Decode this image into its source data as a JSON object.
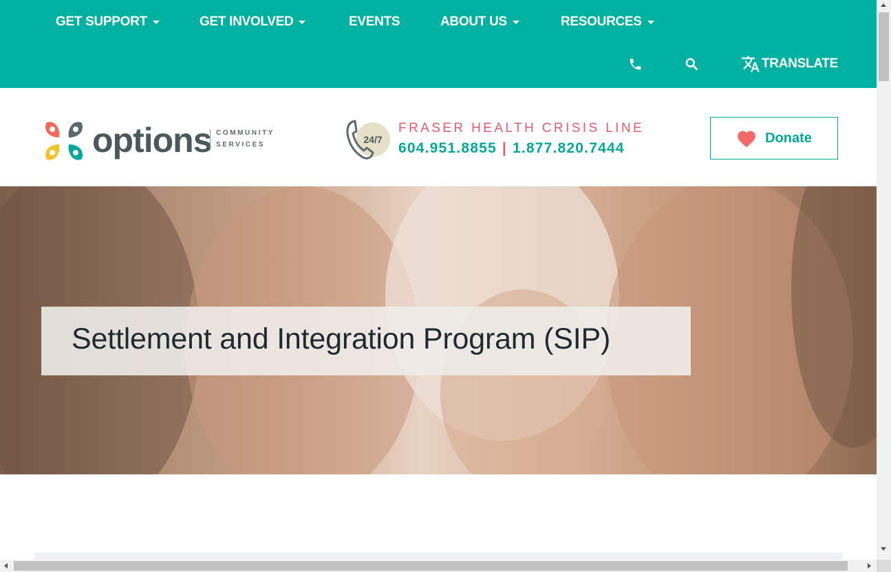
{
  "nav": {
    "items": [
      {
        "label": "GET SUPPORT",
        "has_dropdown": true
      },
      {
        "label": "GET INVOLVED",
        "has_dropdown": true
      },
      {
        "label": "EVENTS",
        "has_dropdown": false
      },
      {
        "label": "ABOUT US",
        "has_dropdown": true
      },
      {
        "label": "RESOURCES",
        "has_dropdown": true
      }
    ],
    "phone_icon": "phone-icon",
    "search_icon": "search-icon",
    "translate_icon": "translate-icon",
    "translate_label": "TRANSLATE"
  },
  "header": {
    "logo_word": "options",
    "logo_sub_line1": "COMMUNITY",
    "logo_sub_line2": "SERVICES",
    "crisis_badge": "24/7",
    "crisis_title": "FRASER HEALTH CRISIS LINE",
    "crisis_phone_1": "604.951.8855",
    "crisis_phone_sep": "|",
    "crisis_phone_2": "1.877.820.7444",
    "donate_label": "Donate"
  },
  "hero": {
    "title": "Settlement and Integration Program (SIP)"
  },
  "colors": {
    "brand_teal": "#00b0a1",
    "accent_pink": "#e85a6b",
    "text_dark": "#1f2a33"
  }
}
